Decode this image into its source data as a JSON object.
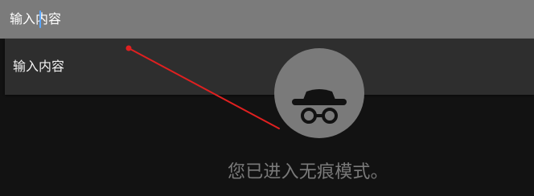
{
  "search": {
    "input_value": "输入内容"
  },
  "suggestions": [
    {
      "label": "输入内容"
    }
  ],
  "incognito": {
    "message": "您已进入无痕模式。",
    "icon": "incognito-icon"
  },
  "colors": {
    "page_background": "#121212",
    "search_bar": "#7b7b7b",
    "suggestion_panel": "#2e2e2e",
    "incognito_gray": "#7a7a7a",
    "caret": "#5aa7ff",
    "annotation": "#e02020"
  }
}
